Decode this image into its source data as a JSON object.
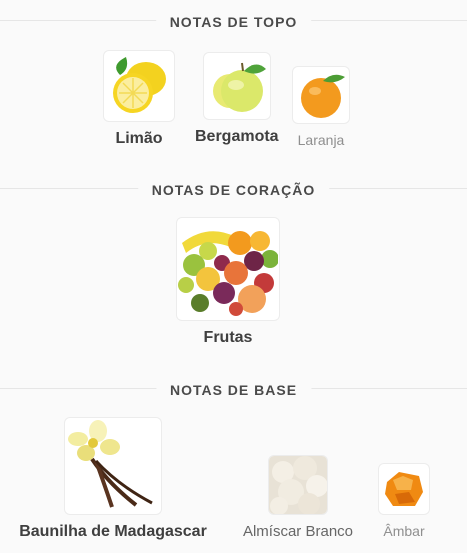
{
  "sections": [
    {
      "title": "NOTAS DE TOPO",
      "notes": [
        {
          "label": "Limão",
          "icon": "lemon-icon"
        },
        {
          "label": "Bergamota",
          "icon": "bergamot-icon"
        },
        {
          "label": "Laranja",
          "icon": "orange-icon"
        }
      ]
    },
    {
      "title": "NOTAS DE CORAÇÃO",
      "notes": [
        {
          "label": "Frutas",
          "icon": "fruits-icon"
        }
      ]
    },
    {
      "title": "NOTAS DE BASE",
      "notes": [
        {
          "label": "Baunilha de Madagascar",
          "icon": "vanilla-icon"
        },
        {
          "label": "Almíscar Branco",
          "icon": "white-musk-icon"
        },
        {
          "label": "Âmbar",
          "icon": "amber-icon"
        }
      ]
    }
  ],
  "colors": {
    "background": "#fafafa",
    "divider": "#e6e6e6",
    "header_text": "#4a4a4a"
  }
}
